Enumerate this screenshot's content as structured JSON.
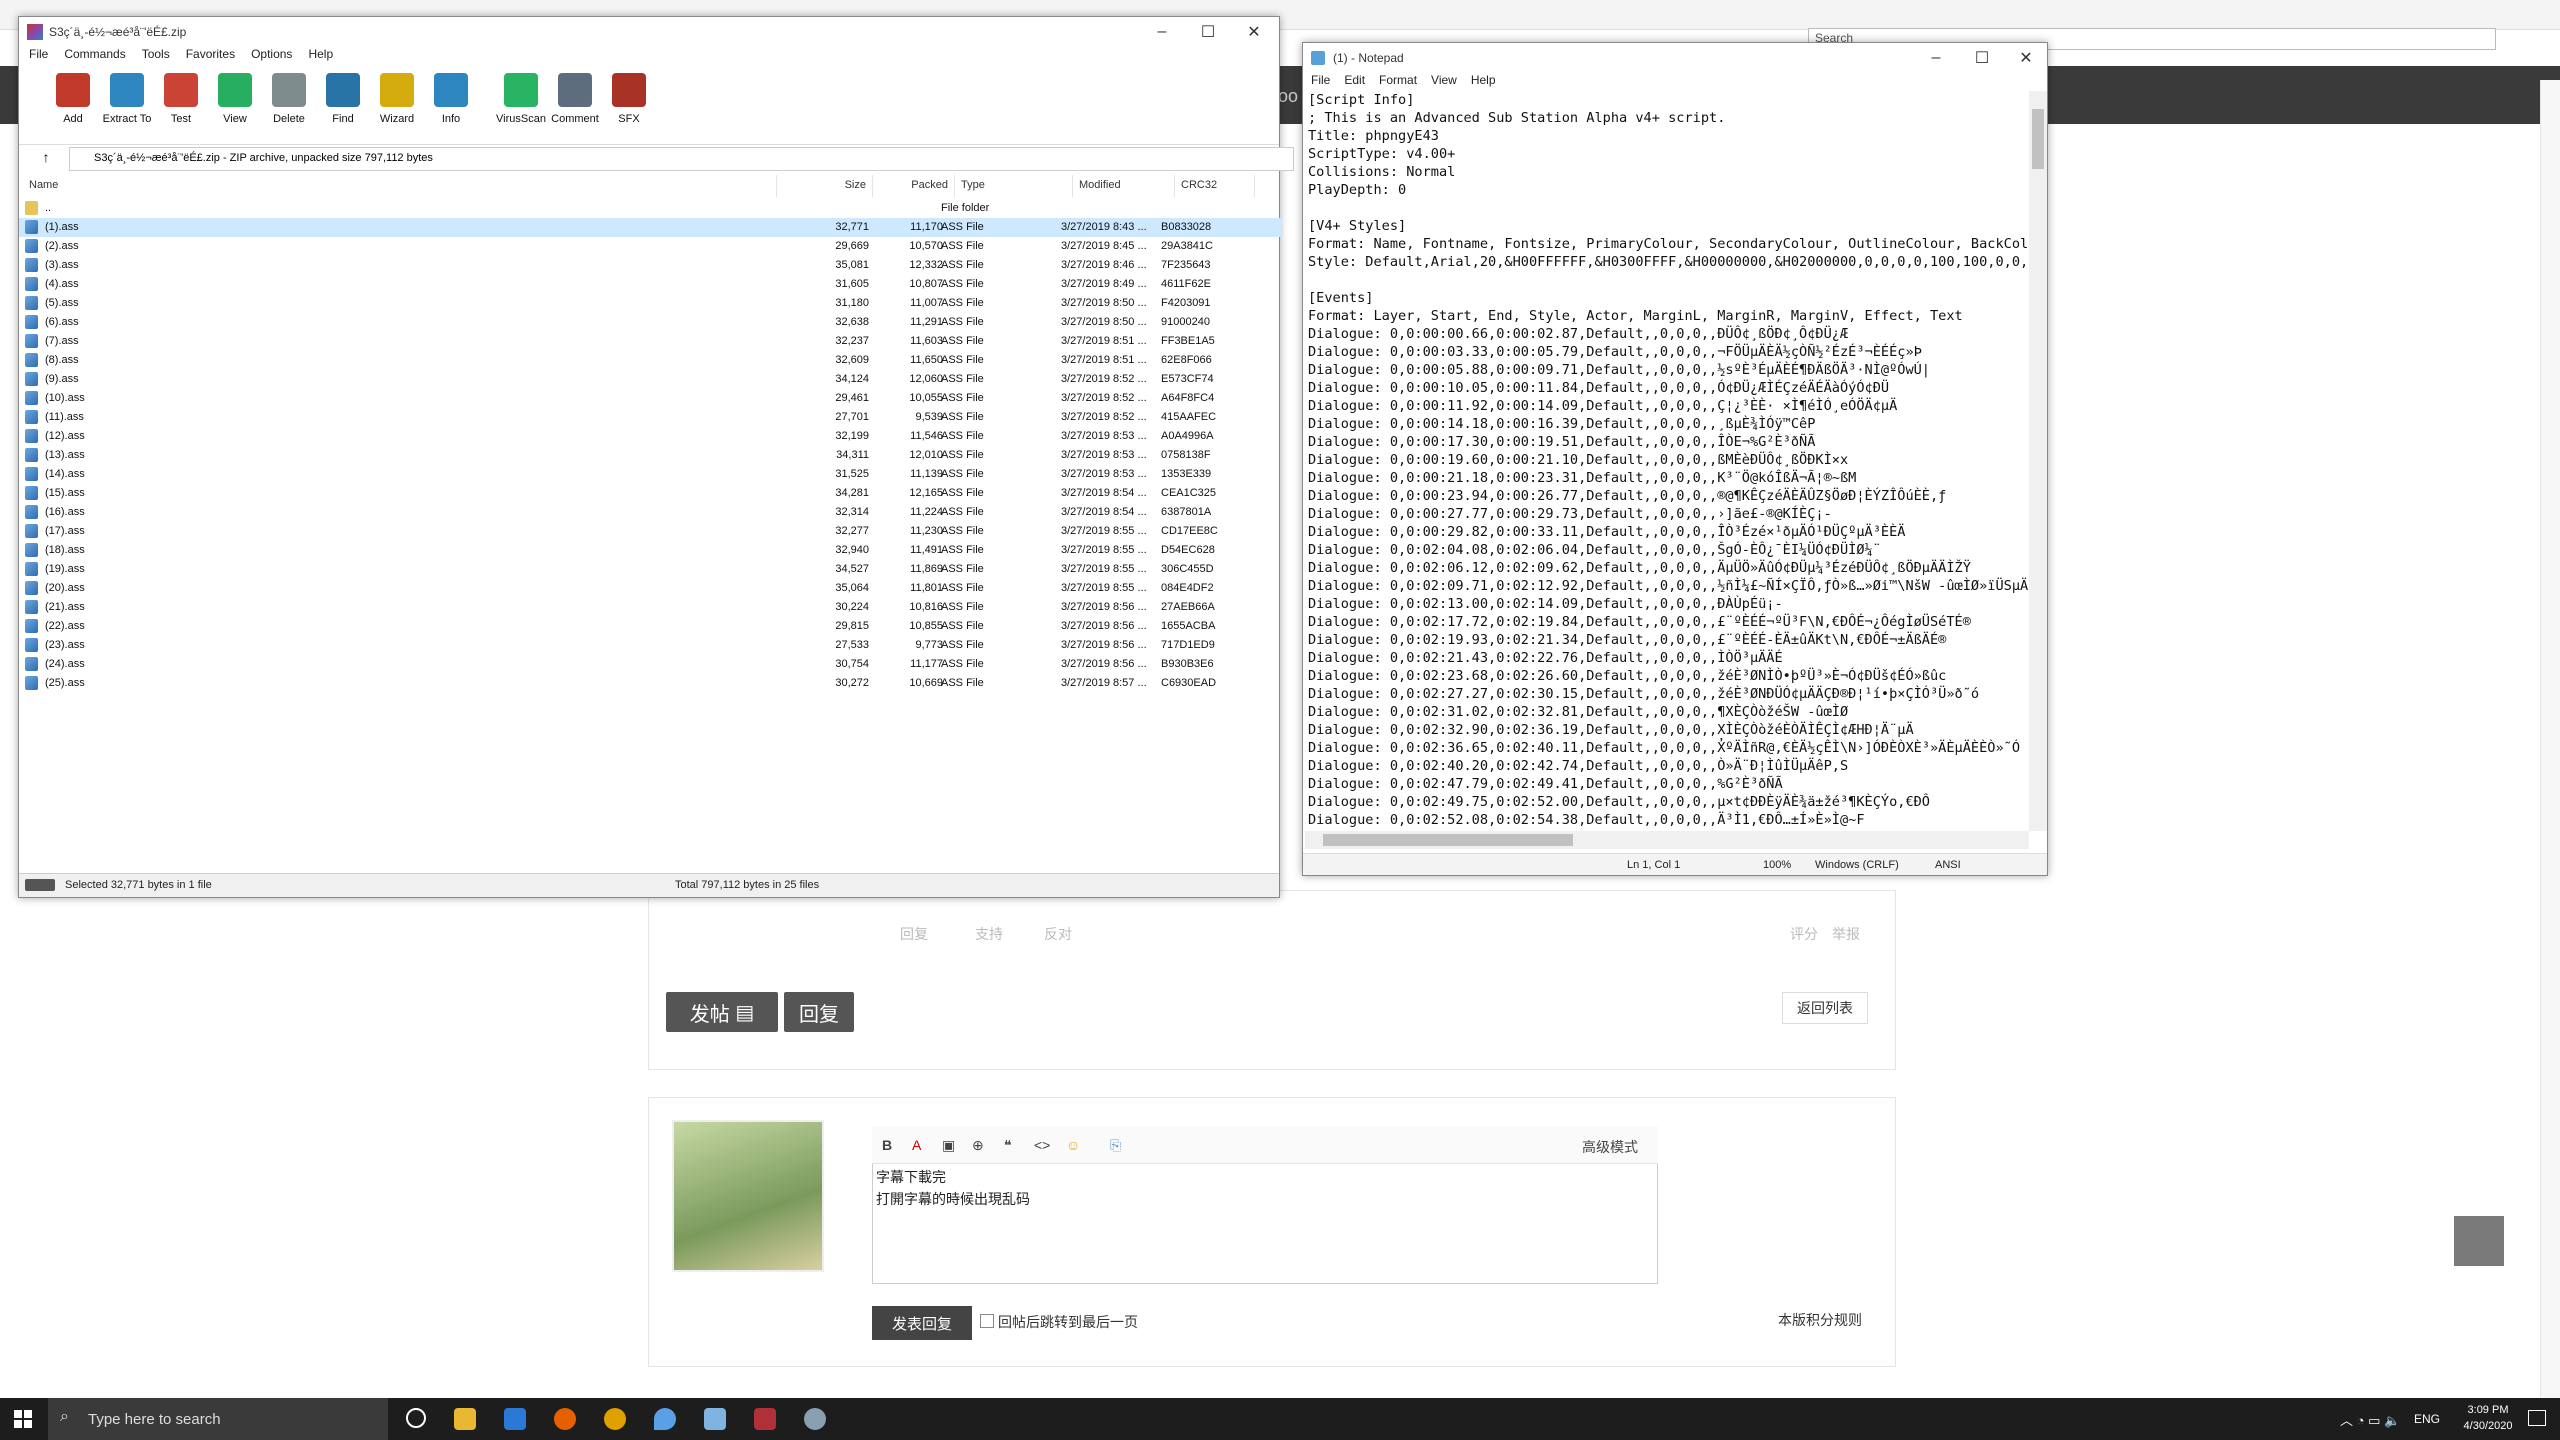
{
  "browser": {
    "search_placeholder": "Search",
    "banner_text": "oo"
  },
  "forum": {
    "post_actions": [
      "回复",
      "支持",
      "反对"
    ],
    "post_actions_right": [
      "评分",
      "举报"
    ],
    "new_post_button": "发帖",
    "reply_tab_button": "回复",
    "back_to_list": "返回列表",
    "editor_advanced_mode": "高级模式",
    "editor_content": [
      "字幕下載完",
      "打開字幕的時候出現乱码"
    ],
    "submit_reply": "发表回复",
    "checkbox_label": "回帖后跳转到最后一页",
    "rules_link": "本版积分规则"
  },
  "winrar": {
    "title": "S3ç´ä¸-é½¬æé³å¨'ëÉ£.zip",
    "menu": [
      "File",
      "Commands",
      "Tools",
      "Favorites",
      "Options",
      "Help"
    ],
    "toolbar": [
      {
        "label": "Add",
        "icon": "add-icon",
        "color": "#c0392b"
      },
      {
        "label": "Extract To",
        "icon": "extract-icon",
        "color": "#2e86c1"
      },
      {
        "label": "Test",
        "icon": "test-icon",
        "color": "#cb4335"
      },
      {
        "label": "View",
        "icon": "view-icon",
        "color": "#27ae60"
      },
      {
        "label": "Delete",
        "icon": "delete-icon",
        "color": "#7f8c8d"
      },
      {
        "label": "Find",
        "icon": "find-icon",
        "color": "#2874a6"
      },
      {
        "label": "Wizard",
        "icon": "wizard-icon",
        "color": "#d4ac0d"
      },
      {
        "label": "Info",
        "icon": "info-icon",
        "color": "#2e86c1"
      },
      {
        "label": "VirusScan",
        "icon": "virusscan-icon",
        "color": "#28b463"
      },
      {
        "label": "Comment",
        "icon": "comment-icon",
        "color": "#5d6d7e"
      },
      {
        "label": "SFX",
        "icon": "sfx-icon",
        "color": "#a93226"
      }
    ],
    "address": "S3ç´ä¸-é½¬æé³å¨'ëÉ£.zip - ZIP archive, unpacked size 797,112 bytes",
    "columns": [
      "Name",
      "Size",
      "Packed",
      "Type",
      "Modified",
      "CRC32"
    ],
    "parent_row": {
      "name": "..",
      "type": "File folder"
    },
    "files": [
      [
        "(1).ass",
        "32,771",
        "11,170",
        "ASS File",
        "3/27/2019 8:43 ...",
        "B0833028"
      ],
      [
        "(2).ass",
        "29,669",
        "10,570",
        "ASS File",
        "3/27/2019 8:45 ...",
        "29A3841C"
      ],
      [
        "(3).ass",
        "35,081",
        "12,332",
        "ASS File",
        "3/27/2019 8:46 ...",
        "7F235643"
      ],
      [
        "(4).ass",
        "31,605",
        "10,807",
        "ASS File",
        "3/27/2019 8:49 ...",
        "4611F62E"
      ],
      [
        "(5).ass",
        "31,180",
        "11,007",
        "ASS File",
        "3/27/2019 8:50 ...",
        "F4203091"
      ],
      [
        "(6).ass",
        "32,638",
        "11,291",
        "ASS File",
        "3/27/2019 8:50 ...",
        "91000240"
      ],
      [
        "(7).ass",
        "32,237",
        "11,603",
        "ASS File",
        "3/27/2019 8:51 ...",
        "FF3BE1A5"
      ],
      [
        "(8).ass",
        "32,609",
        "11,650",
        "ASS File",
        "3/27/2019 8:51 ...",
        "62E8F066"
      ],
      [
        "(9).ass",
        "34,124",
        "12,060",
        "ASS File",
        "3/27/2019 8:52 ...",
        "E573CF74"
      ],
      [
        "(10).ass",
        "29,461",
        "10,055",
        "ASS File",
        "3/27/2019 8:52 ...",
        "A64F8FC4"
      ],
      [
        "(11).ass",
        "27,701",
        "9,539",
        "ASS File",
        "3/27/2019 8:52 ...",
        "415AAFEC"
      ],
      [
        "(12).ass",
        "32,199",
        "11,546",
        "ASS File",
        "3/27/2019 8:53 ...",
        "A0A4996A"
      ],
      [
        "(13).ass",
        "34,311",
        "12,010",
        "ASS File",
        "3/27/2019 8:53 ...",
        "0758138F"
      ],
      [
        "(14).ass",
        "31,525",
        "11,139",
        "ASS File",
        "3/27/2019 8:53 ...",
        "1353E339"
      ],
      [
        "(15).ass",
        "34,281",
        "12,165",
        "ASS File",
        "3/27/2019 8:54 ...",
        "CEA1C325"
      ],
      [
        "(16).ass",
        "32,314",
        "11,224",
        "ASS File",
        "3/27/2019 8:54 ...",
        "6387801A"
      ],
      [
        "(17).ass",
        "32,277",
        "11,230",
        "ASS File",
        "3/27/2019 8:55 ...",
        "CD17EE8C"
      ],
      [
        "(18).ass",
        "32,940",
        "11,491",
        "ASS File",
        "3/27/2019 8:55 ...",
        "D54EC628"
      ],
      [
        "(19).ass",
        "34,527",
        "11,869",
        "ASS File",
        "3/27/2019 8:55 ...",
        "306C455D"
      ],
      [
        "(20).ass",
        "35,064",
        "11,801",
        "ASS File",
        "3/27/2019 8:55 ...",
        "084E4DF2"
      ],
      [
        "(21).ass",
        "30,224",
        "10,816",
        "ASS File",
        "3/27/2019 8:56 ...",
        "27AEB66A"
      ],
      [
        "(22).ass",
        "29,815",
        "10,855",
        "ASS File",
        "3/27/2019 8:56 ...",
        "1655ACBA"
      ],
      [
        "(23).ass",
        "27,533",
        "9,773",
        "ASS File",
        "3/27/2019 8:56 ...",
        "717D1ED9"
      ],
      [
        "(24).ass",
        "30,754",
        "11,177",
        "ASS File",
        "3/27/2019 8:56 ...",
        "B930B3E6"
      ],
      [
        "(25).ass",
        "30,272",
        "10,669",
        "ASS File",
        "3/27/2019 8:57 ...",
        "C6930EAD"
      ]
    ],
    "status_left": "Selected 32,771 bytes in 1 file",
    "status_right": "Total 797,112 bytes in 25 files"
  },
  "notepad": {
    "title": "(1) - Notepad",
    "menu": [
      "File",
      "Edit",
      "Format",
      "View",
      "Help"
    ],
    "lines": [
      "[Script Info]",
      "; This is an Advanced Sub Station Alpha v4+ script.",
      "Title: phpngyE43",
      "ScriptType: v4.00+",
      "Collisions: Normal",
      "PlayDepth: 0",
      "",
      "[V4+ Styles]",
      "Format: Name, Fontname, Fontsize, PrimaryColour, SecondaryColour, OutlineColour, BackColou",
      "Style: Default,Arial,20,&H00FFFFFF,&H0300FFFF,&H00000000,&H02000000,0,0,0,0,100,100,0,0,1,",
      "",
      "[Events]",
      "Format: Layer, Start, End, Style, Actor, MarginL, MarginR, MarginV, Effect, Text",
      "Dialogue: 0,0:00:00.66,0:00:02.87,Default,,0,0,0,,ÐÜÔ¢¸ßÖÐ¢¸Ô¢ÐÜ¿Æ",
      "Dialogue: 0,0:00:03.33,0:00:05.79,Default,,0,0,0,,¬FÖÜµÄÈÄ½çÒÑ½²ÉzÉ³¬ÈÉÉç»Þ",
      "Dialogue: 0,0:00:05.88,0:00:09.71,Default,,0,0,0,,½sºÈ³ÉµÄÈÉ¶ÐÄßÖÄ³·NÌ@ºÓwÚ|",
      "Dialogue: 0,0:00:10.05,0:00:11.84,Default,,0,0,0,,Ó¢ÐÜ¿ÆÌÉÇzéÄÉÄàÓýÓ¢ÐÜ",
      "Dialogue: 0,0:00:11.92,0:00:14.09,Default,,0,0,0,,Ç¦¿³ÈÈ· ×Ì¶éÌÓ¸eÓÖÄ¢µÄ",
      "Dialogue: 0,0:00:14.18,0:00:16.39,Default,,0,0,0,,¸ßµÈ¾ÌÓÿ™CêP",
      "Dialogue: 0,0:00:17.30,0:00:19.51,Default,,0,0,0,,ÎÒE¬%G²È³ðÑÃ",
      "Dialogue: 0,0:00:19.60,0:00:21.10,Default,,0,0,0,,ßMÈèÐÜÔ¢¸ßÖÐKÌ×x",
      "Dialogue: 0,0:00:21.18,0:00:23.31,Default,,0,0,0,,K³¨Ö@kóÎßÄ¬Ã¦®~ßM",
      "Dialogue: 0,0:00:23.94,0:00:26.77,Default,,0,0,0,,®@¶KÊÇzéÄÈÄÛZ§ÖøÐ¦ÈÝZÎÔúÈÈ,ƒ",
      "Dialogue: 0,0:00:27.77,0:00:29.73,Default,,0,0,0,,›]ãe£-®@KÍÈÇ¡-",
      "Dialogue: 0,0:00:29.82,0:00:33.11,Default,,0,0,0,,ÎÒ³Ézé×¹ðµÄÓ¹ÐÜÇºµÄ³ÈÈÄ",
      "Dialogue: 0,0:02:04.08,0:02:06.04,Default,,0,0,0,,ŠgÓ-ÈÔ¿¯ÈI¼ÜÓ¢ÐÜÌØ¼¨",
      "Dialogue: 0,0:02:06.12,0:02:09.62,Default,,0,0,0,,ÄµÜÖ»ÄûÓ¢ÐÜµ¼³ÉzéÐÜÔ¢¸ßÖÐµÄÄÌŽŸ",
      "Dialogue: 0,0:02:09.71,0:02:12.92,Default,,0,0,0,,½ñÌ¼£~ÑÍ×ÇÏÔ,ƒÒ»ß…»Øi™\\NšW -ûœÌØ»ïÜSµÄÓ¢",
      "Dialogue: 0,0:02:13.00,0:02:14.09,Default,,0,0,0,,ÐÀÙpÉü¡-",
      "Dialogue: 0,0:02:17.72,0:02:19.84,Default,,0,0,0,,£¨ºÈÉÉ¬ºÜ³F\\N,€ÐÔÉ¬¿ÔégÌøÜSéTÉ®",
      "Dialogue: 0,0:02:19.93,0:02:21.34,Default,,0,0,0,,£¨ºÈÉÉ-ÈÄ±ûÄKt\\N,€ÐÔÉ¬±ÄßÄÉ®",
      "Dialogue: 0,0:02:21.43,0:02:22.76,Default,,0,0,0,,ÌÒÖ³µÄÄÉ",
      "Dialogue: 0,0:02:23.68,0:02:26.60,Default,,0,0,0,,žéÈ³ØNÌÒ•þºÜ³»È¬Ó¢ÐÜš¢ÉÓ»ßûc",
      "Dialogue: 0,0:02:27.27,0:02:30.15,Default,,0,0,0,,žéÈ³ØNÐÜÓ¢µÄÄÇÐ®Ð¦¹í•þ×ÇÌÓ³Ü»ð˜ó",
      "Dialogue: 0,0:02:31.02,0:02:32.81,Default,,0,0,0,,¶XÈÇÒòžéŠW -ûœÌØ",
      "Dialogue: 0,0:02:32.90,0:02:36.19,Default,,0,0,0,,XÌÈÇÒòžéÈÒÄÌÊÇÌ¢ÆHÐ¦Ä¨µÄ",
      "Dialogue: 0,0:02:36.65,0:02:40.11,Default,,0,0,0,,X̓ºÄÌñR@,€ÈÄ½çÊÌ\\N›]ÓÐÈÒXÈ³»ÄÈµÄÈÈÒ»˜Ó",
      "Dialogue: 0,0:02:40.20,0:02:42.74,Default,,0,0,0,,Ò»Ä¨Ð¦ÌûÌÜµÄêP,S",
      "Dialogue: 0,0:02:47.79,0:02:49.41,Default,,0,0,0,,%G²È³ðÑÃ",
      "Dialogue: 0,0:02:49.75,0:02:52.00,Default,,0,0,0,,µ×t¢ÐÐÈÿÄÈ¾ä±žé³¶KÈÇÝo,€ÐÔ",
      "Dialogue: 0,0:02:52.08,0:02:54.38,Default,,0,0,0,,Ä³Ì1,€ÐÔ…±Í»È»Ì@~F"
    ],
    "status_pos": "Ln 1, Col 1",
    "status_zoom": "100%",
    "status_eol": "Windows (CRLF)",
    "status_enc": "ANSI"
  },
  "taskbar": {
    "search_placeholder": "Type here to search",
    "lang": "ENG",
    "time": "3:09 PM",
    "date": "4/30/2020"
  }
}
